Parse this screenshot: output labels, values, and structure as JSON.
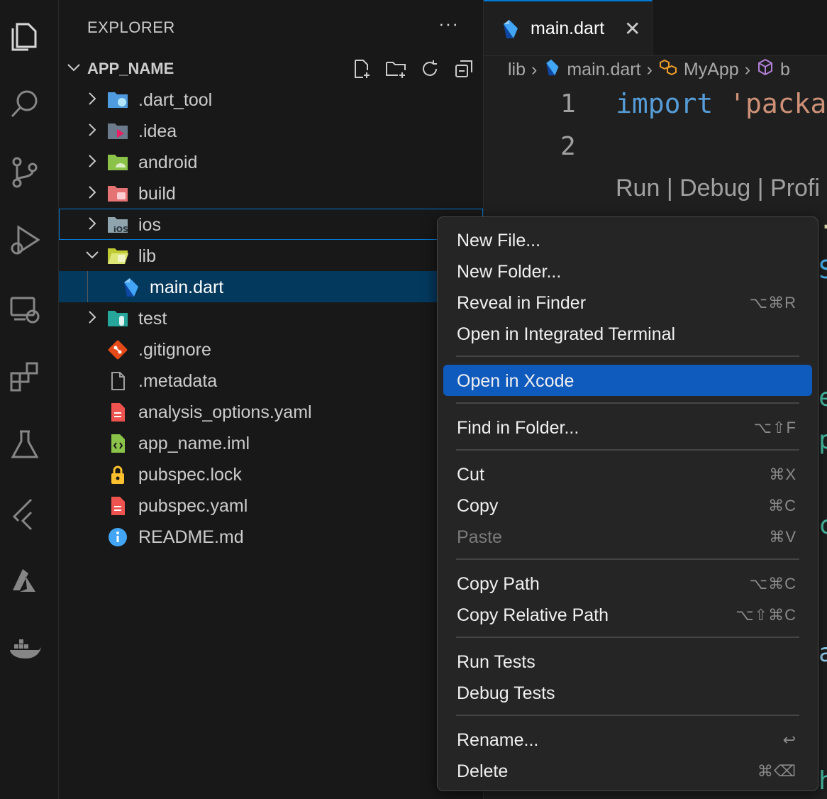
{
  "activity_bar": {
    "icons": [
      "files-icon",
      "search-icon",
      "source-control-icon",
      "run-debug-icon",
      "remote-explorer-icon",
      "extensions-icon",
      "testing-icon",
      "flutter-icon",
      "azure-icon",
      "docker-icon"
    ]
  },
  "sidebar": {
    "title": "EXPLORER",
    "more": "···",
    "project_name": "APP_NAME",
    "items": [
      {
        "label": ".dart_tool",
        "type": "folder",
        "icon": "dart-tool-folder-icon",
        "color": "#4e9be0"
      },
      {
        "label": ".idea",
        "type": "folder",
        "icon": "idea-folder-icon",
        "color": "#6b7b8c"
      },
      {
        "label": "android",
        "type": "folder",
        "icon": "android-folder-icon",
        "color": "#8bc34a"
      },
      {
        "label": "build",
        "type": "folder",
        "icon": "build-folder-icon",
        "color": "#e57373"
      },
      {
        "label": "ios",
        "type": "folder",
        "icon": "ios-folder-icon",
        "color": "#90a4ae",
        "badge": "iOS"
      },
      {
        "label": "lib",
        "type": "folder-open",
        "icon": "lib-folder-icon",
        "color": "#c0ca33"
      },
      {
        "label": "main.dart",
        "type": "file",
        "icon": "dart-file-icon",
        "color": "#42a5f5"
      },
      {
        "label": "test",
        "type": "folder",
        "icon": "test-folder-icon",
        "color": "#26a69a"
      },
      {
        "label": ".gitignore",
        "type": "file",
        "icon": "git-icon",
        "color": "#e64a19"
      },
      {
        "label": ".metadata",
        "type": "file",
        "icon": "file-icon",
        "color": "#a0a0a0"
      },
      {
        "label": "analysis_options.yaml",
        "type": "file",
        "icon": "yaml-icon",
        "color": "#ef5350"
      },
      {
        "label": "app_name.iml",
        "type": "file",
        "icon": "iml-icon",
        "color": "#8bc34a"
      },
      {
        "label": "pubspec.lock",
        "type": "file",
        "icon": "lock-icon",
        "color": "#fbc02d"
      },
      {
        "label": "pubspec.yaml",
        "type": "file",
        "icon": "yaml-icon",
        "color": "#ef5350"
      },
      {
        "label": "README.md",
        "type": "file",
        "icon": "info-icon",
        "color": "#42a5f5"
      }
    ]
  },
  "editor": {
    "tab_label": "main.dart",
    "tab_close": "✕",
    "breadcrumbs": [
      "lib",
      "main.dart",
      "MyApp",
      "b"
    ],
    "line_numbers": [
      "1",
      "2"
    ],
    "code_keyword": "import",
    "code_string": " 'packa",
    "codelens": "Run | Debug | Profi"
  },
  "context_menu": {
    "groups": [
      [
        {
          "label": "New File...",
          "shortcut": ""
        },
        {
          "label": "New Folder...",
          "shortcut": ""
        },
        {
          "label": "Reveal in Finder",
          "shortcut": "⌥⌘R"
        },
        {
          "label": "Open in Integrated Terminal",
          "shortcut": ""
        }
      ],
      [
        {
          "label": "Open in Xcode",
          "shortcut": "",
          "active": true
        }
      ],
      [
        {
          "label": "Find in Folder...",
          "shortcut": "⌥⇧F"
        }
      ],
      [
        {
          "label": "Cut",
          "shortcut": "⌘X"
        },
        {
          "label": "Copy",
          "shortcut": "⌘C"
        },
        {
          "label": "Paste",
          "shortcut": "⌘V",
          "disabled": true
        }
      ],
      [
        {
          "label": "Copy Path",
          "shortcut": "⌥⌘C"
        },
        {
          "label": "Copy Relative Path",
          "shortcut": "⌥⇧⌘C"
        }
      ],
      [
        {
          "label": "Run Tests",
          "shortcut": ""
        },
        {
          "label": "Debug Tests",
          "shortcut": ""
        }
      ],
      [
        {
          "label": "Rename...",
          "shortcut": "↩"
        },
        {
          "label": "Delete",
          "shortcut": "⌘⌫"
        }
      ]
    ]
  }
}
